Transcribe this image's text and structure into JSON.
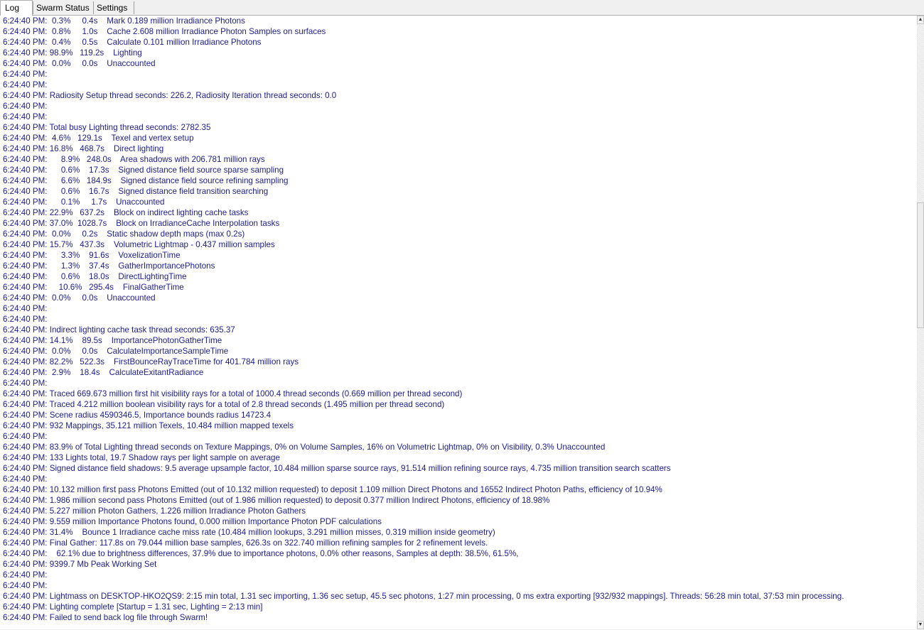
{
  "tabs": [
    {
      "label": "Log",
      "active": true
    },
    {
      "label": "Swarm Status",
      "active": false
    },
    {
      "label": "Settings",
      "active": false
    }
  ],
  "log": {
    "scroll_thumb_icon": "scroll-thumb",
    "lines": [
      "6:24:40 PM:  0.3%     0.4s    Mark 0.189 million Irradiance Photons",
      "6:24:40 PM:  0.8%     1.0s    Cache 2.608 million Irradiance Photon Samples on surfaces",
      "6:24:40 PM:  0.4%     0.5s    Calculate 0.101 million Irradiance Photons",
      "6:24:40 PM: 98.9%   119.2s    Lighting",
      "6:24:40 PM:  0.0%     0.0s    Unaccounted",
      "6:24:40 PM:",
      "6:24:40 PM:",
      "6:24:40 PM: Radiosity Setup thread seconds: 226.2, Radiosity Iteration thread seconds: 0.0",
      "6:24:40 PM:",
      "6:24:40 PM:",
      "6:24:40 PM: Total busy Lighting thread seconds: 2782.35",
      "6:24:40 PM:  4.6%   129.1s    Texel and vertex setup",
      "6:24:40 PM: 16.8%   468.7s    Direct lighting",
      "6:24:40 PM:      8.9%   248.0s    Area shadows with 206.781 million rays",
      "6:24:40 PM:      0.6%    17.3s    Signed distance field source sparse sampling",
      "6:24:40 PM:      6.6%   184.9s    Signed distance field source refining sampling",
      "6:24:40 PM:      0.6%    16.7s    Signed distance field transition searching",
      "6:24:40 PM:      0.1%     1.7s    Unaccounted",
      "6:24:40 PM: 22.9%   637.2s    Block on indirect lighting cache tasks",
      "6:24:40 PM: 37.0%  1028.7s    Block on IrradianceCache Interpolation tasks",
      "6:24:40 PM:  0.0%     0.2s    Static shadow depth maps (max 0.2s)",
      "6:24:40 PM: 15.7%   437.3s    Volumetric Lightmap - 0.437 million samples",
      "6:24:40 PM:      3.3%    91.6s    VoxelizationTime",
      "6:24:40 PM:      1.3%    37.4s    GatherImportancePhotons",
      "6:24:40 PM:      0.6%    18.0s    DirectLightingTime",
      "6:24:40 PM:     10.6%   295.4s    FinalGatherTime",
      "6:24:40 PM:  0.0%     0.0s    Unaccounted",
      "6:24:40 PM:",
      "6:24:40 PM:",
      "6:24:40 PM: Indirect lighting cache task thread seconds: 635.37",
      "6:24:40 PM: 14.1%    89.5s    ImportancePhotonGatherTime",
      "6:24:40 PM:  0.0%     0.0s    CalculateImportanceSampleTime",
      "6:24:40 PM: 82.2%   522.3s    FirstBounceRayTraceTime for 401.784 million rays",
      "6:24:40 PM:  2.9%    18.4s    CalculateExitantRadiance",
      "6:24:40 PM:",
      "6:24:40 PM: Traced 669.673 million first hit visibility rays for a total of 1000.4 thread seconds (0.669 million per thread second)",
      "6:24:40 PM: Traced 4.212 million boolean visibility rays for a total of 2.8 thread seconds (1.495 million per thread second)",
      "6:24:40 PM: Scene radius 4590346.5, Importance bounds radius 14723.4",
      "6:24:40 PM: 932 Mappings, 35.121 million Texels, 10.484 million mapped texels",
      "6:24:40 PM:",
      "6:24:40 PM: 83.9% of Total Lighting thread seconds on Texture Mappings, 0% on Volume Samples, 16% on Volumetric Lightmap, 0% on Visibility, 0.3% Unaccounted",
      "6:24:40 PM: 133 Lights total, 19.7 Shadow rays per light sample on average",
      "6:24:40 PM: Signed distance field shadows: 9.5 average upsample factor, 10.484 million sparse source rays, 91.514 million refining source rays, 4.735 million transition search scatters",
      "6:24:40 PM:",
      "6:24:40 PM: 10.132 million first pass Photons Emitted (out of 10.132 million requested) to deposit 1.109 million Direct Photons and 16552 Indirect Photon Paths, efficiency of 10.94%",
      "6:24:40 PM: 1.986 million second pass Photons Emitted (out of 1.986 million requested) to deposit 0.377 million Indirect Photons, efficiency of 18.98%",
      "6:24:40 PM: 5.227 million Photon Gathers, 1.226 million Irradiance Photon Gathers",
      "6:24:40 PM: 9.559 million Importance Photons found, 0.000 million Importance Photon PDF calculations",
      "6:24:40 PM: 31.4%    Bounce 1 Irradiance cache miss rate (10.484 million lookups, 3.291 million misses, 0.319 million inside geometry)",
      "6:24:40 PM: Final Gather: 117.8s on 79.044 million base samples, 626.3s on 322.740 million refining samples for 2 refinement levels.",
      "6:24:40 PM:    62.1% due to brightness differences, 37.9% due to importance photons, 0.0% other reasons, Samples at depth: 38.5%, 61.5%,",
      "6:24:40 PM: 9399.7 Mb Peak Working Set",
      "6:24:40 PM:",
      "6:24:40 PM:",
      "6:24:40 PM: Lightmass on DESKTOP-HKO2QS9: 2:15 min total, 1.31 sec importing, 1.36 sec setup, 45.5 sec photons, 1:27 min processing, 0 ms extra exporting [932/932 mappings]. Threads: 56:28 min total, 37:53 min processing.",
      "6:24:40 PM: Lighting complete [Startup = 1.31 sec, Lighting = 2:13 min]",
      "6:24:40 PM: Failed to send back log file through Swarm!"
    ]
  }
}
